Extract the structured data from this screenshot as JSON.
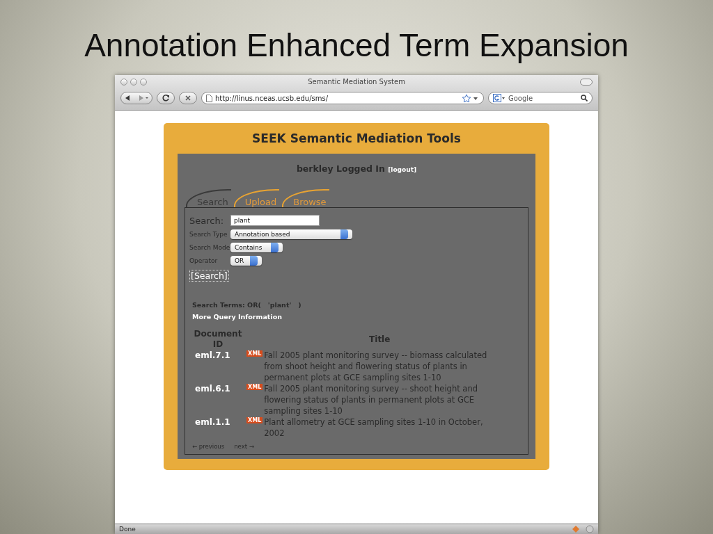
{
  "slide": {
    "title": "Annotation Enhanced Term Expansion"
  },
  "browser": {
    "title": "Semantic Mediation System",
    "url": "http://linus.nceas.ucsb.edu/sms/",
    "search_placeholder": "Google",
    "status": "Done"
  },
  "app": {
    "heading": "SEEK Semantic Mediation Tools",
    "user": "berkley Logged In",
    "logout": "[logout]",
    "tabs": [
      {
        "label": "Search",
        "selected": true
      },
      {
        "label": "Upload",
        "selected": false
      },
      {
        "label": "Browse",
        "selected": false
      }
    ],
    "form": {
      "search_label": "Search:",
      "search_value": "plant",
      "fields": [
        {
          "label": "Search Type",
          "value": "Annotation based"
        },
        {
          "label": "Search Mode",
          "value": "Contains"
        },
        {
          "label": "Operator",
          "value": "OR"
        }
      ],
      "submit": "[Search]"
    },
    "search_terms": "Search Terms: OR(   'plant'   )",
    "more_info": "More Query Information",
    "table": {
      "columns": [
        "Document ID",
        "Title"
      ],
      "rows": [
        {
          "id": "eml.7.1",
          "badge": "XML",
          "title": "Fall 2005 plant monitoring survey -- biomass calculated from shoot height and flowering status of plants in permanent plots at GCE sampling sites 1-10"
        },
        {
          "id": "eml.6.1",
          "badge": "XML",
          "title": "Fall 2005 plant monitoring survey -- shoot height and flowering status of plants in permanent plots at GCE sampling sites 1-10"
        },
        {
          "id": "eml.1.1",
          "badge": "XML",
          "title": "Plant allometry at GCE sampling sites 1-10 in October, 2002"
        }
      ]
    },
    "pager": {
      "previous": "← previous",
      "next": "next →"
    }
  }
}
